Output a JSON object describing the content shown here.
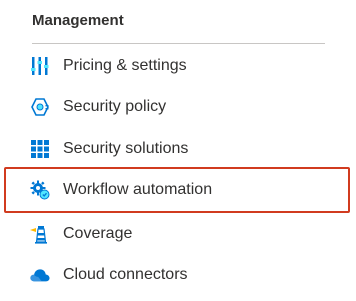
{
  "section": {
    "title": "Management"
  },
  "items": [
    {
      "label": "Pricing & settings",
      "icon": "pricing-bars-icon"
    },
    {
      "label": "Security policy",
      "icon": "security-policy-icon"
    },
    {
      "label": "Security solutions",
      "icon": "grid-solutions-icon"
    },
    {
      "label": "Workflow automation",
      "icon": "gear-automation-icon",
      "highlighted": true
    },
    {
      "label": "Coverage",
      "icon": "lighthouse-icon"
    },
    {
      "label": "Cloud connectors",
      "icon": "cloud-icon"
    }
  ],
  "colors": {
    "highlight_border": "#d13b1f",
    "icon_blue": "#0078d4"
  }
}
